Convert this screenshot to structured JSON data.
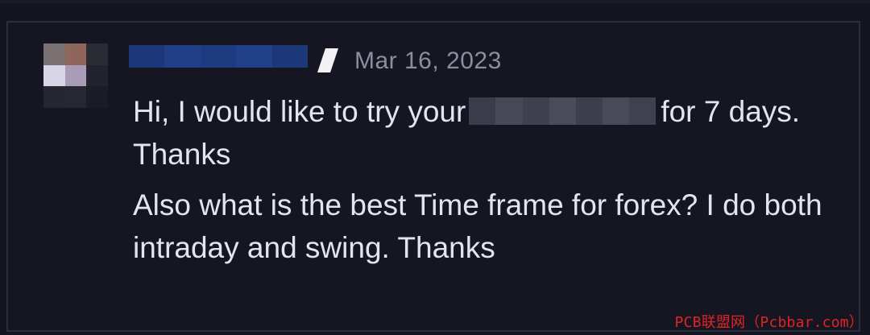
{
  "comment": {
    "timestamp": "Mar 16, 2023",
    "message_part1": "Hi, I would like to try your",
    "message_part2": "for 7 days.",
    "message_line2": "Thanks",
    "message_line3": "Also what is the best Time frame for forex? I do both intraday and swing. Thanks"
  },
  "watermark": {
    "text": "PCB联盟网（Pcbbar.com）"
  },
  "icons": {
    "avatar": "pixelated-avatar",
    "separator": "slash-separator-icon"
  },
  "colors": {
    "background": "#141521",
    "card_border": "#2b2e3d",
    "message_text": "#e3e5ed",
    "timestamp_text": "#8b8e9c",
    "username_blur": "#1f3a78",
    "watermark": "#e02424"
  }
}
